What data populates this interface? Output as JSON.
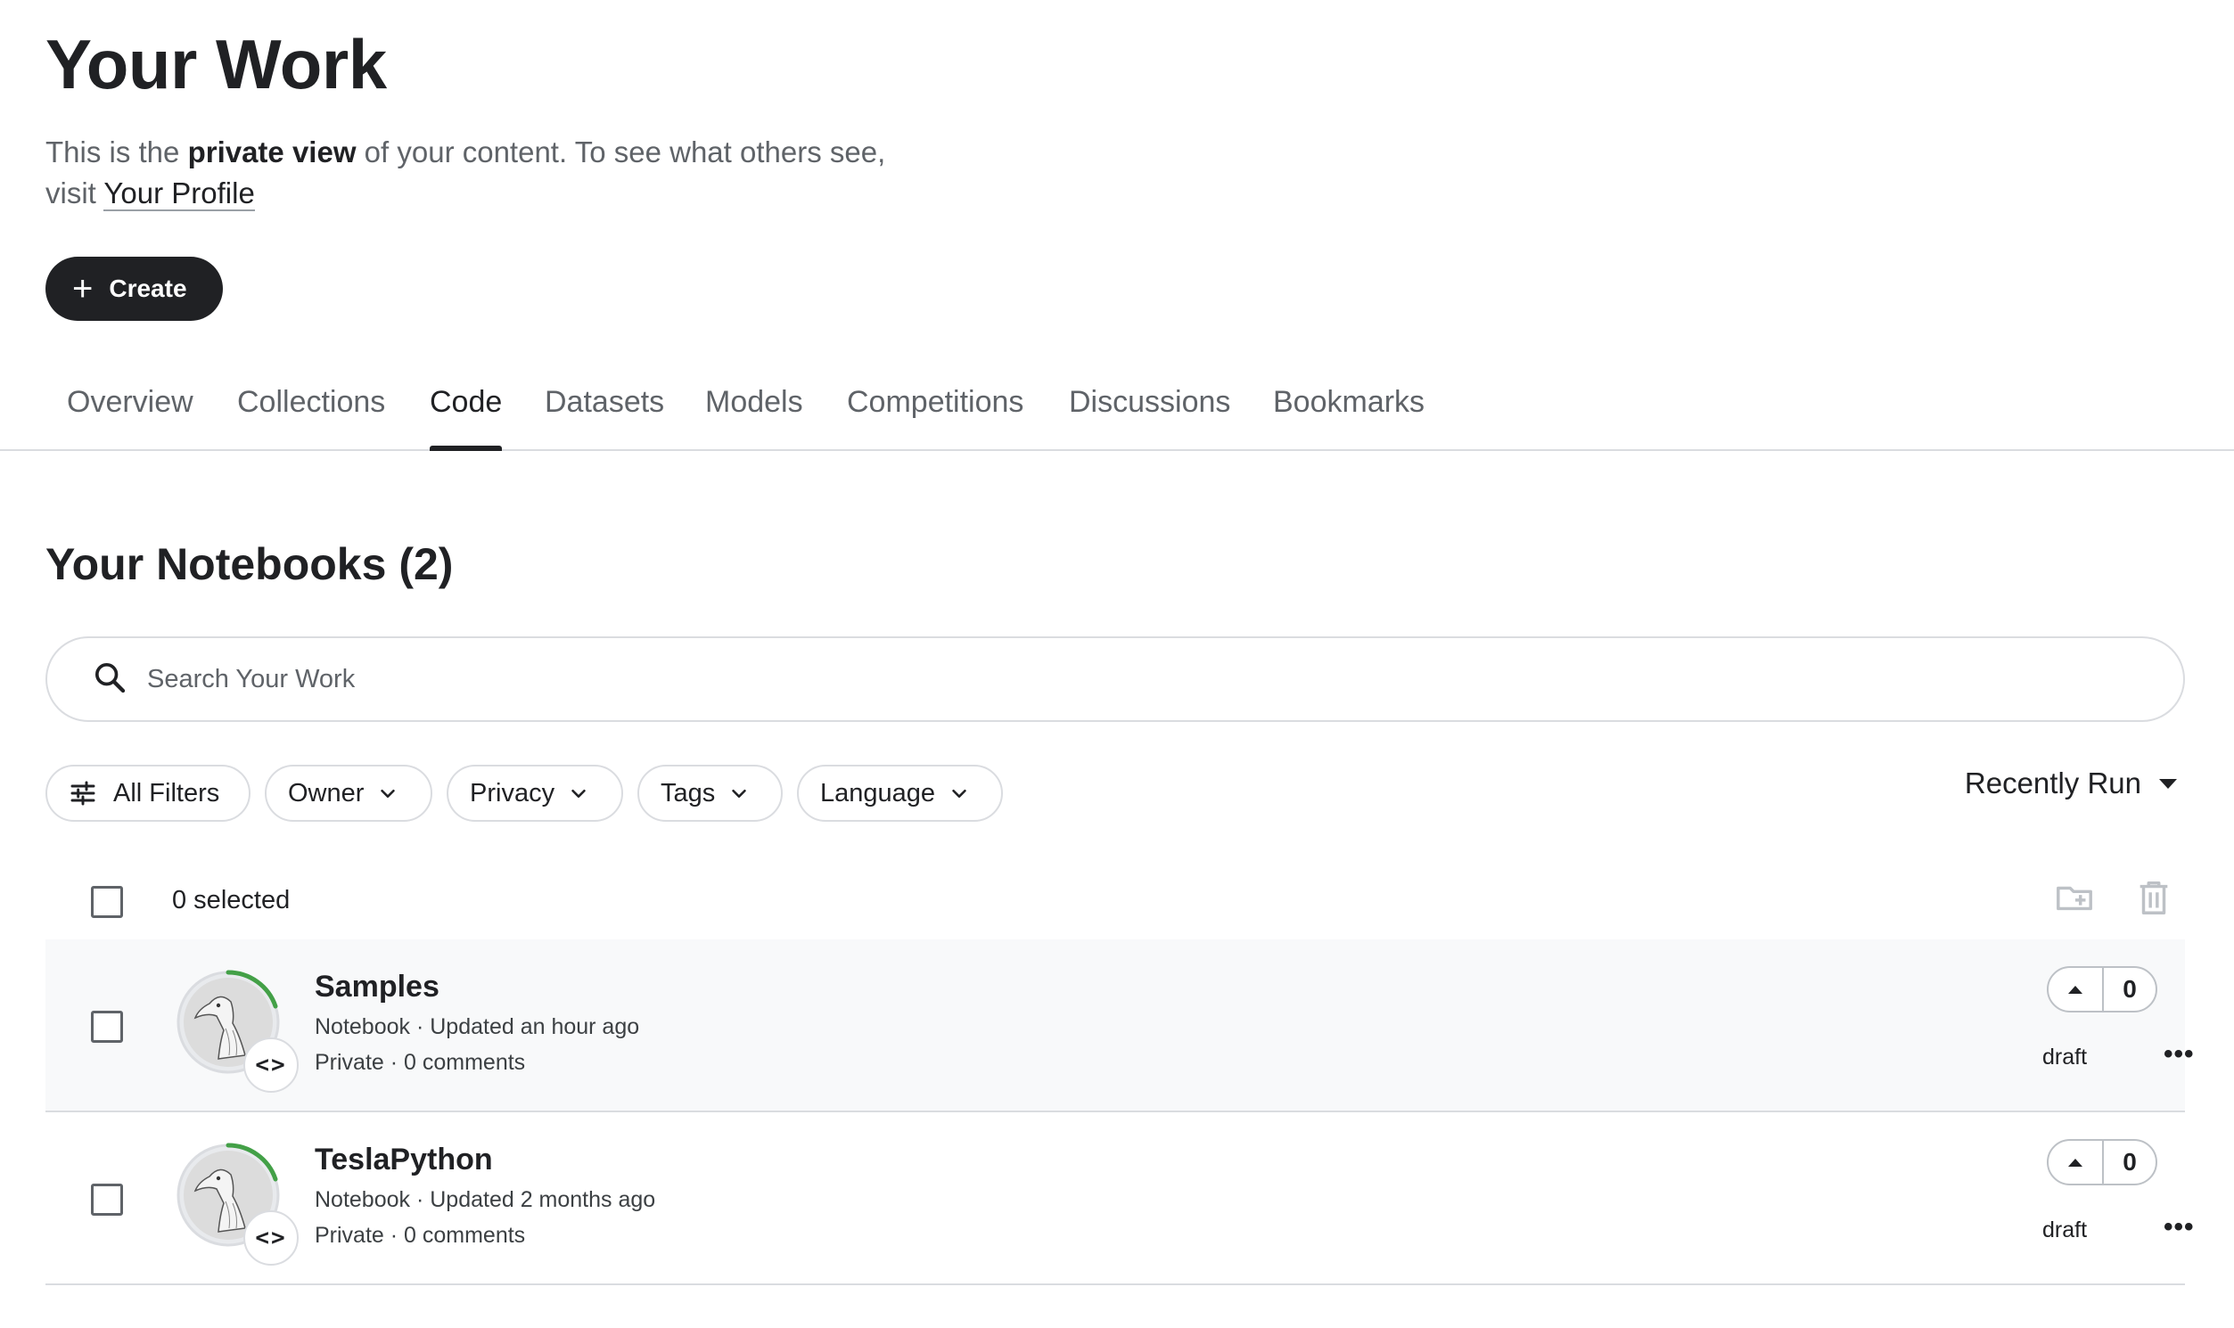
{
  "header": {
    "title": "Your Work",
    "intro_prefix": "This is the",
    "intro_bold": "private view",
    "intro_middle": "of your content. To see what others see, visit",
    "profile_link": "Your Profile",
    "create_label": "Create"
  },
  "tabs": [
    {
      "label": "Overview",
      "active": false
    },
    {
      "label": "Collections",
      "active": false
    },
    {
      "label": "Code",
      "active": true
    },
    {
      "label": "Datasets",
      "active": false
    },
    {
      "label": "Models",
      "active": false
    },
    {
      "label": "Competitions",
      "active": false
    },
    {
      "label": "Discussions",
      "active": false
    },
    {
      "label": "Bookmarks",
      "active": false
    }
  ],
  "section": {
    "title": "Your Notebooks (2)"
  },
  "search": {
    "placeholder": "Search Your Work",
    "icon": "search-icon"
  },
  "filters": [
    {
      "label": "All Filters",
      "icon": "tune-icon"
    },
    {
      "label": "Owner",
      "icon": "chevron-down-icon"
    },
    {
      "label": "Privacy",
      "icon": "chevron-down-icon"
    },
    {
      "label": "Tags",
      "icon": "chevron-down-icon"
    },
    {
      "label": "Language",
      "icon": "chevron-down-icon"
    }
  ],
  "sort": {
    "label": "Recently Run"
  },
  "selection": {
    "count_label": "0 selected",
    "actions": [
      "create-new-folder-icon",
      "trash-icon"
    ]
  },
  "notebooks": [
    {
      "title": "Samples",
      "meta1": "Notebook · Updated an hour ago",
      "meta2": "Private · 0 comments",
      "votes": "0",
      "status": "draft",
      "highlight": true
    },
    {
      "title": "TeslaPython",
      "meta1": "Notebook · Updated 2 months ago",
      "meta2": "Private · 0 comments",
      "votes": "0",
      "status": "draft",
      "highlight": false
    }
  ],
  "colors": {
    "text": "#202124",
    "muted": "#5f6368",
    "border": "#dadce0",
    "row_highlight": "#f8f9fa",
    "progress_ring": "#43a047",
    "button_dark": "#202124"
  }
}
